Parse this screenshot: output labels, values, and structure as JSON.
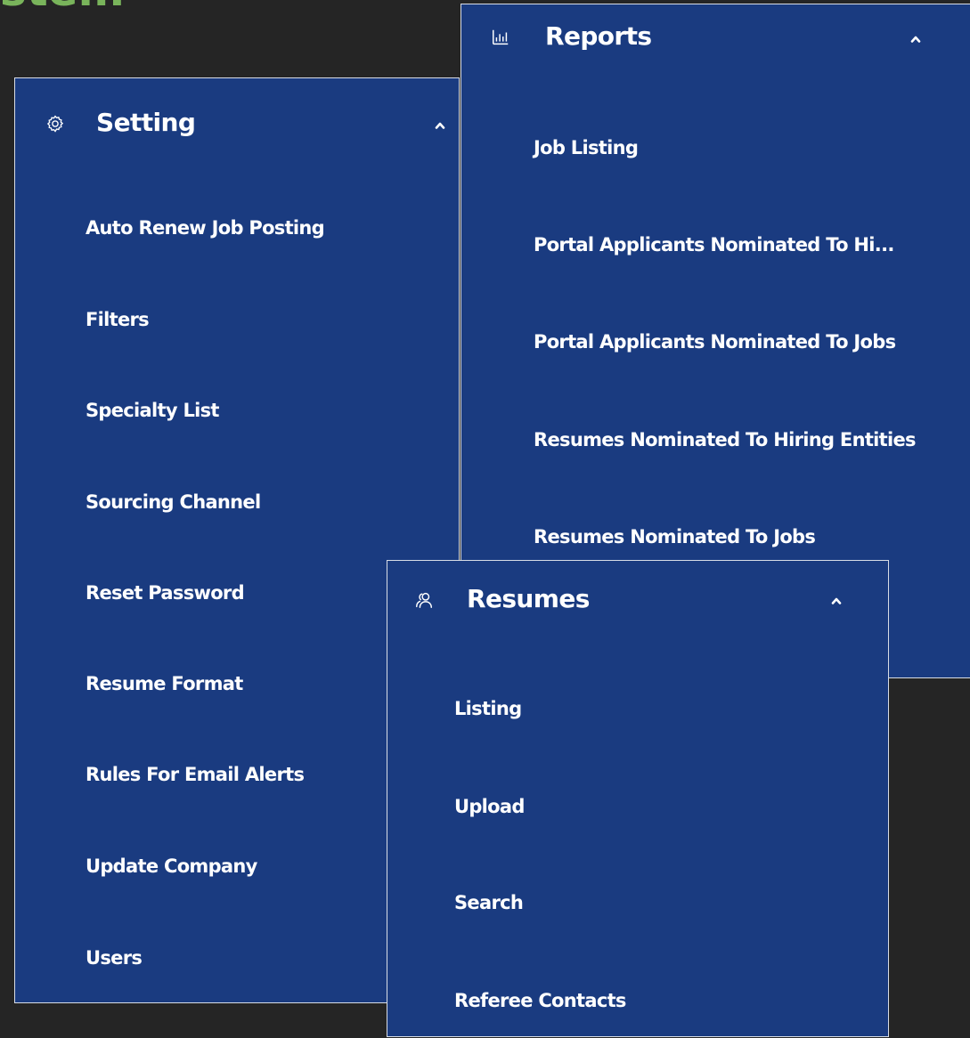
{
  "background_heading": "stem",
  "colors": {
    "page_background": "#252525",
    "panel_background": "#1a3b80",
    "panel_border": "#d8dde6",
    "text": "#ffffff",
    "heading_green": "#79b45b"
  },
  "setting": {
    "title": "Setting",
    "icon": "gear-icon",
    "chevron": "chevron-up-icon",
    "items": [
      "Auto Renew Job Posting",
      "Filters",
      "Specialty List",
      "Sourcing Channel",
      "Reset Password",
      "Resume Format",
      "Rules For Email Alerts",
      "Update Company",
      "Users"
    ]
  },
  "reports": {
    "title": "Reports",
    "icon": "bar-chart-icon",
    "chevron": "chevron-up-icon",
    "items": [
      "Job Listing",
      "Portal Applicants Nominated To Hi...",
      "Portal Applicants Nominated To Jobs",
      "Resumes Nominated To Hiring Entities",
      "Resumes Nominated To Jobs"
    ]
  },
  "resumes": {
    "title": "Resumes",
    "icon": "users-icon",
    "chevron": "chevron-up-icon",
    "items": [
      "Listing",
      "Upload",
      "Search",
      "Referee Contacts"
    ]
  }
}
